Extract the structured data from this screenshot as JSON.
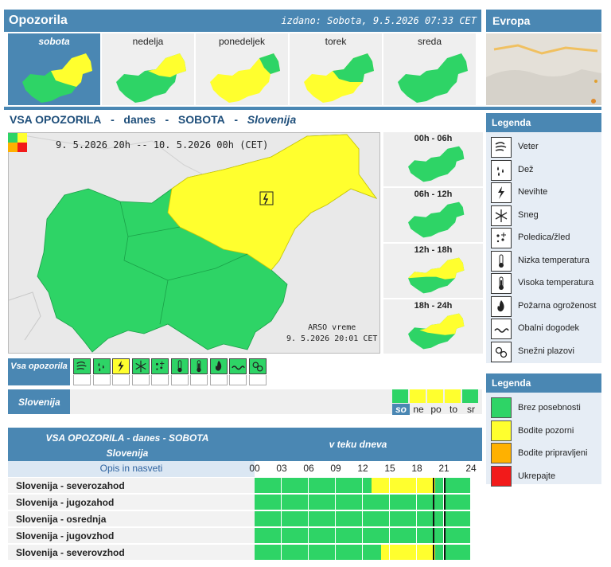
{
  "header": {
    "title": "Opozorila",
    "issued": "izdano: Sobota, 9.5.2026 07:33 CET",
    "europe": "Evropa"
  },
  "days": [
    {
      "label": "sobota",
      "selected": true
    },
    {
      "label": "nedelja",
      "selected": false
    },
    {
      "label": "ponedeljek",
      "selected": false
    },
    {
      "label": "torek",
      "selected": false
    },
    {
      "label": "sreda",
      "selected": false
    }
  ],
  "main": {
    "title": {
      "a": "VSA OPOZORILA",
      "sep": "-",
      "b": "danes",
      "c": "SOBOTA",
      "d": "Slovenija"
    },
    "period": "9. 5.2026  20h  --  10. 5.2026  00h   (CET)",
    "credit1": "ARSO vreme",
    "credit2": "9. 5.2026  20:01 CET"
  },
  "slots": [
    "00h - 06h",
    "06h - 12h",
    "12h - 18h",
    "18h - 24h"
  ],
  "strip": {
    "vsa_label": "Vsa opozorila",
    "region": "Slovenija",
    "days": [
      "so",
      "ne",
      "po",
      "to",
      "sr"
    ],
    "day_levels": [
      "green",
      "yellow",
      "yellow",
      "yellow",
      "green"
    ],
    "icon_levels": [
      "green",
      "green",
      "yellow",
      "green",
      "green",
      "green",
      "green",
      "green",
      "green",
      "green"
    ]
  },
  "table": {
    "title1": "VSA OPOZORILA - danes - SOBOTA",
    "title2": "Slovenija",
    "title3": "v teku dneva",
    "opis": "Opis in nasveti",
    "hours": [
      "00",
      "03",
      "06",
      "09",
      "12",
      "15",
      "18",
      "21",
      "24"
    ],
    "rows": [
      {
        "name": "Slovenija - severozahod",
        "yellow": [
          13.0,
          20.0
        ]
      },
      {
        "name": "Slovenija - jugozahod",
        "yellow": null
      },
      {
        "name": "Slovenija - osrednja",
        "yellow": null
      },
      {
        "name": "Slovenija - jugovzhod",
        "yellow": null
      },
      {
        "name": "Slovenija - severovzhod",
        "yellow": [
          14.0,
          20.0
        ]
      }
    ],
    "now_hours": [
      19.8,
      21.0
    ]
  },
  "legend": {
    "title": "Legenda",
    "items": [
      "Veter",
      "Dež",
      "Nevihte",
      "Sneg",
      "Poledica/žled",
      "Nizka temperatura",
      "Visoka temperatura",
      "Požarna ogroženost",
      "Obalni dogodek",
      "Snežni plazovi"
    ],
    "icons": [
      "wind-icon",
      "rain-icon",
      "thunderstorm-icon",
      "snow-icon",
      "ice-icon",
      "low-temperature-icon",
      "high-temperature-icon",
      "fire-icon",
      "coastal-icon",
      "avalanche-icon"
    ]
  },
  "legend2": {
    "title": "Legenda",
    "items": [
      "Brez posebnosti",
      "Bodite pozorni",
      "Bodite pripravljeni",
      "Ukrepajte"
    ],
    "colors": [
      "#2ed466",
      "#ffff2e",
      "#ffb100",
      "#f21a1a"
    ]
  },
  "colors": {
    "green": "#2ed466",
    "yellow": "#ffff2e",
    "accent": "#4a87b3"
  }
}
